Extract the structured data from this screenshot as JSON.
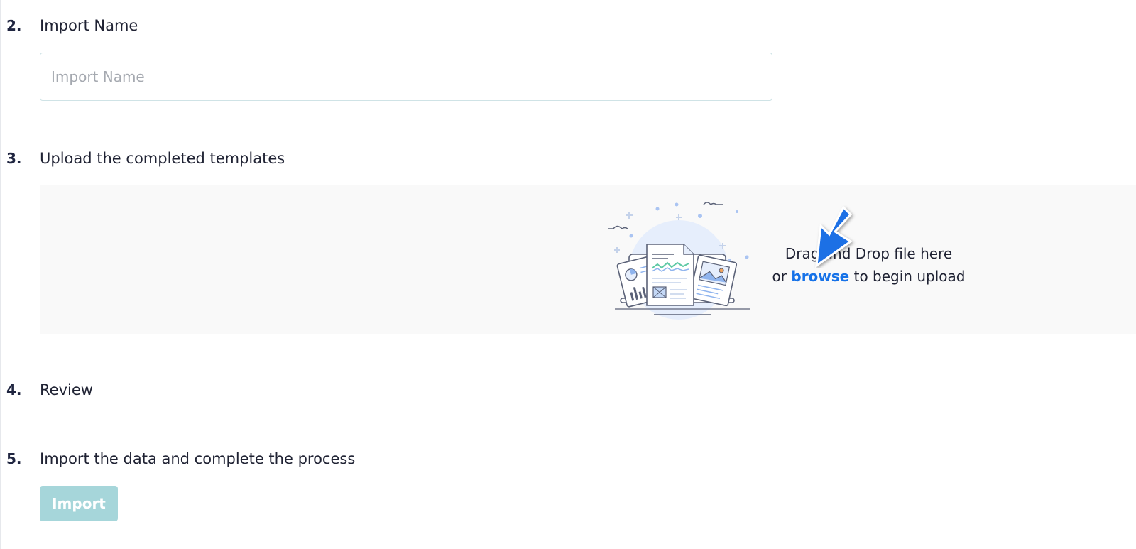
{
  "steps": {
    "import_name": {
      "number": "2.",
      "title": "Import Name",
      "placeholder": "Import Name"
    },
    "upload": {
      "number": "3.",
      "title": "Upload the completed templates",
      "drop_line1": "Drag and Drop file here",
      "drop_prefix": "or ",
      "browse": "browse",
      "drop_suffix": " to begin upload"
    },
    "review": {
      "number": "4.",
      "title": "Review"
    },
    "finish": {
      "number": "5.",
      "title": "Import the data and complete the process",
      "button": "Import"
    }
  },
  "colors": {
    "accent_link": "#1672e8",
    "button_disabled": "#a6d6da",
    "dropzone_bg": "#f9f9f9",
    "cursor_arrow": "#1f6fe5"
  },
  "icons": {
    "illustration": "documents-upload-illustration",
    "cursor": "pointer-arrow-icon"
  }
}
